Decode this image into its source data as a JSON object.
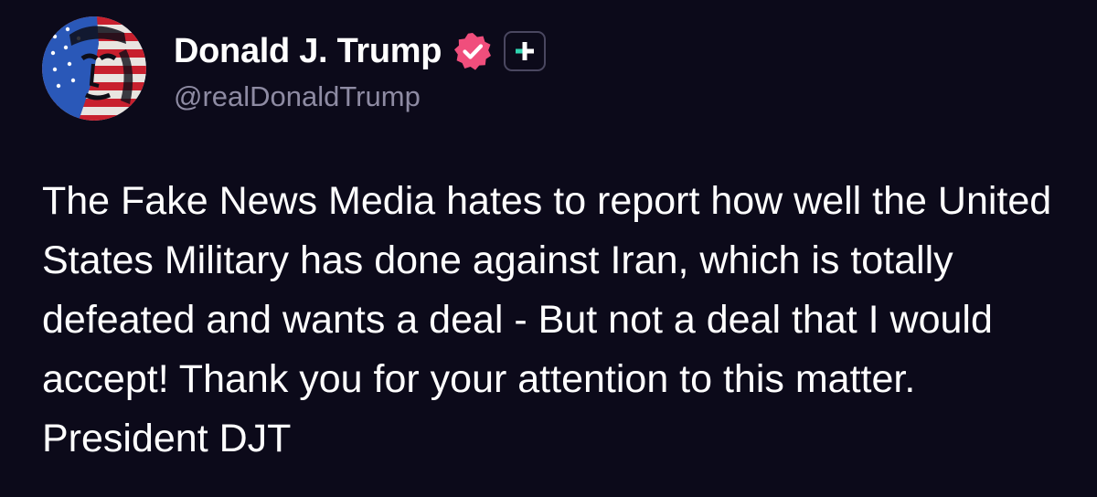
{
  "post": {
    "author": {
      "display_name": "Donald J. Trump",
      "handle": "@realDonaldTrump",
      "avatar_icon": "flag-portrait-avatar",
      "verified_icon": "verified-badge-icon",
      "verified_color": "#f04e7c",
      "subscription_icon": "truth-plus-badge-icon",
      "subscription_color": "#2fd4b0"
    },
    "body": "The Fake News Media hates to report how well the United States Military has done against Iran, which is totally defeated and wants a deal - But not a deal that I would accept! Thank you for your attention to this matter. President DJT"
  },
  "theme": {
    "background": "#0c0a1a",
    "text": "#ffffff",
    "muted": "#8e8ba3"
  }
}
